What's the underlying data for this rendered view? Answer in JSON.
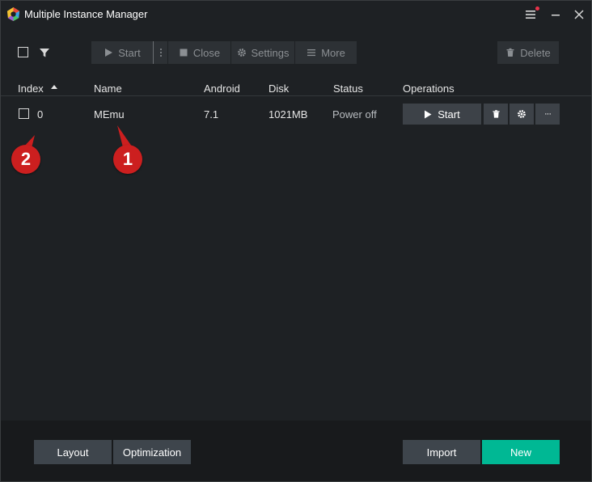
{
  "window": {
    "title": "Multiple Instance Manager",
    "icons": [
      "app-logo-icon",
      "hamburger-menu-icon",
      "minimize-icon",
      "close-icon"
    ],
    "notification_color": "#e8334a"
  },
  "toolbar": {
    "start_label": "Start",
    "close_label": "Close",
    "settings_label": "Settings",
    "more_label": "More",
    "delete_label": "Delete",
    "icons": [
      "filter-icon",
      "play-icon",
      "vertical-dots-icon",
      "stop-icon",
      "gear-icon",
      "list-icon",
      "trash-icon"
    ]
  },
  "table": {
    "columns": [
      "Index",
      "Name",
      "Android",
      "Disk",
      "Status",
      "Operations"
    ],
    "sort": {
      "column": "Index",
      "direction": "ascending"
    },
    "rows": [
      {
        "index": "0",
        "name": "MEmu",
        "android": "7.1",
        "disk": "1021MB",
        "status": "Power off",
        "start_label": "Start",
        "more_label": "···"
      }
    ]
  },
  "annotations": {
    "badge_1": "1",
    "badge_2": "2",
    "color": "#cc1f1f"
  },
  "footer": {
    "layout_label": "Layout",
    "optimization_label": "Optimization",
    "import_label": "Import",
    "new_label": "New",
    "new_color": "#00b894"
  }
}
